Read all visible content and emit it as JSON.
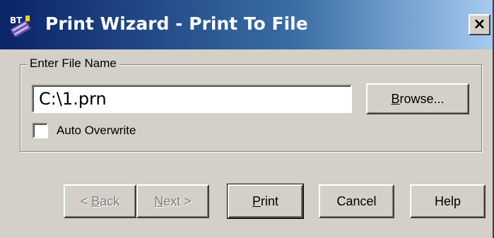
{
  "window": {
    "title": "Print Wizard - Print To File",
    "close_label": "×",
    "colors": {
      "titlebar_start": "#0a246a",
      "titlebar_end": "#a6caf0",
      "face": "#d4d0c8"
    }
  },
  "file_group": {
    "label": "Enter File Name",
    "file_name_value": "C:\\1.prn",
    "browse": {
      "accel": "B",
      "rest": "rowse..."
    },
    "auto_overwrite": {
      "label": "Auto Overwrite",
      "checked": false
    }
  },
  "footer": {
    "back": {
      "prefix": "< ",
      "accel": "B",
      "rest": "ack",
      "enabled": false
    },
    "next": {
      "accel": "N",
      "rest": "ext >",
      "enabled": false
    },
    "print": {
      "accel": "P",
      "rest": "rint"
    },
    "cancel_label": "Cancel",
    "help_label": "Help"
  },
  "icons": {
    "app": "bartender-app-icon",
    "close": "close-icon"
  }
}
